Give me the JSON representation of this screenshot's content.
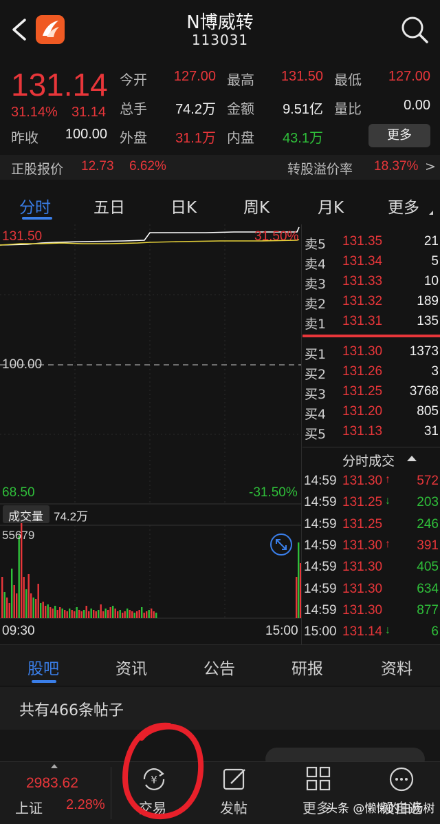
{
  "header": {
    "title": "N博威转",
    "code": "113031"
  },
  "quote": {
    "price": "131.14",
    "change_pct": "31.14%",
    "change_amt": "31.14",
    "fields": [
      {
        "label": "今开",
        "value": "127.00",
        "color": "red"
      },
      {
        "label": "最高",
        "value": "131.50",
        "color": "red"
      },
      {
        "label": "最低",
        "value": "127.00",
        "color": "red"
      },
      {
        "label": "总手",
        "value": "74.2万",
        "color": "white"
      },
      {
        "label": "金额",
        "value": "9.51亿",
        "color": "white"
      },
      {
        "label": "量比",
        "value": "0.00",
        "color": "white"
      },
      {
        "label": "昨收",
        "value": "100.00",
        "color": "white"
      },
      {
        "label": "外盘",
        "value": "31.1万",
        "color": "red"
      },
      {
        "label": "内盘",
        "value": "43.1万",
        "color": "green"
      }
    ],
    "more_button": "更多"
  },
  "premium": {
    "stock_label": "正股报价",
    "stock_price": "12.73",
    "stock_pct": "6.62%",
    "premium_label": "转股溢价率",
    "premium_value": "18.37%",
    "arrow": ">"
  },
  "chart_tabs": [
    "分时",
    "五日",
    "日K",
    "周K",
    "月K",
    "更多"
  ],
  "chart": {
    "high_price": "131.50",
    "high_pct": "31.50%",
    "mid_price": "100.00",
    "low_price": "68.50",
    "low_pct": "-31.50%",
    "volume_label": "成交量",
    "volume_value": "74.2万",
    "volume_max": "55679",
    "time_start": "09:30",
    "time_end": "15:00",
    "colors": {
      "up": "#e8363a",
      "down": "#2fbf3a",
      "price_line": "#ffffff",
      "avg_line": "#e6d23a"
    }
  },
  "order_book": {
    "asks": [
      {
        "label": "卖5",
        "price": "131.35",
        "vol": "21"
      },
      {
        "label": "卖4",
        "price": "131.34",
        "vol": "5"
      },
      {
        "label": "卖3",
        "price": "131.33",
        "vol": "10"
      },
      {
        "label": "卖2",
        "price": "131.32",
        "vol": "189"
      },
      {
        "label": "卖1",
        "price": "131.31",
        "vol": "135"
      }
    ],
    "bids": [
      {
        "label": "买1",
        "price": "131.30",
        "vol": "1373"
      },
      {
        "label": "买2",
        "price": "131.26",
        "vol": "3"
      },
      {
        "label": "买3",
        "price": "131.25",
        "vol": "3768"
      },
      {
        "label": "买4",
        "price": "131.20",
        "vol": "805"
      },
      {
        "label": "买5",
        "price": "131.13",
        "vol": "31"
      }
    ]
  },
  "ticks": {
    "header": "分时成交",
    "rows": [
      {
        "time": "14:59",
        "price": "131.30",
        "dir": "↑",
        "vol": "572",
        "vol_color": "red"
      },
      {
        "time": "14:59",
        "price": "131.25",
        "dir": "↓",
        "vol": "203",
        "vol_color": "green"
      },
      {
        "time": "14:59",
        "price": "131.25",
        "dir": "",
        "vol": "246",
        "vol_color": "green"
      },
      {
        "time": "14:59",
        "price": "131.30",
        "dir": "↑",
        "vol": "391",
        "vol_color": "red"
      },
      {
        "time": "14:59",
        "price": "131.30",
        "dir": "",
        "vol": "405",
        "vol_color": "green"
      },
      {
        "time": "14:59",
        "price": "131.30",
        "dir": "",
        "vol": "634",
        "vol_color": "green"
      },
      {
        "time": "14:59",
        "price": "131.30",
        "dir": "",
        "vol": "877",
        "vol_color": "green"
      },
      {
        "time": "15:00",
        "price": "131.14",
        "dir": "↓",
        "vol": "6",
        "vol_color": "green"
      }
    ]
  },
  "section_tabs": [
    "股吧",
    "资讯",
    "公告",
    "研报",
    "资料"
  ],
  "posts": {
    "count_text": "共有466条帖子"
  },
  "bottom_nav": {
    "index_value": "2983.62",
    "index_name": "上证",
    "index_pct": "2.28%",
    "items": [
      {
        "label": "交易",
        "icon": "yuan-exchange-icon"
      },
      {
        "label": "发帖",
        "icon": "compose-icon"
      },
      {
        "label": "更多",
        "icon": "grid-icon"
      },
      {
        "label": "设自选",
        "icon": "more-dots-icon"
      }
    ]
  },
  "watermark": "头条 @懒懒的白杨树"
}
